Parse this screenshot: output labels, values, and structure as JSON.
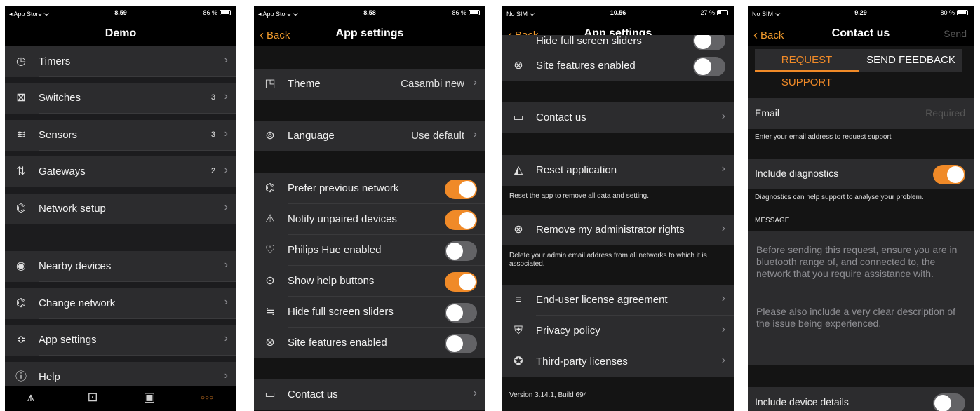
{
  "screens": [
    {
      "status": {
        "left": "◂ App Store ᯤ",
        "time": "8.59",
        "battery": "86 %"
      },
      "title": "Demo",
      "menu": [
        {
          "label": "Timers",
          "icon": "clock-icon",
          "count": ""
        },
        {
          "label": "Switches",
          "icon": "switch-icon",
          "count": "3"
        },
        {
          "label": "Sensors",
          "icon": "sensor-icon",
          "count": "3"
        },
        {
          "label": "Gateways",
          "icon": "gateway-icon",
          "count": "2"
        },
        {
          "label": "Network setup",
          "icon": "network-icon",
          "count": ""
        },
        {
          "label": "Nearby devices",
          "icon": "nearby-icon",
          "count": ""
        },
        {
          "label": "Change network",
          "icon": "change-network-icon",
          "count": ""
        },
        {
          "label": "App settings",
          "icon": "settings-sliders-icon",
          "count": ""
        },
        {
          "label": "Help",
          "icon": "info-icon",
          "count": ""
        }
      ],
      "tabs": [
        {
          "icon": "lamp-icon"
        },
        {
          "icon": "gallery-icon"
        },
        {
          "icon": "scenes-icon"
        },
        {
          "icon": "more-icon",
          "glyph": "○○○"
        }
      ]
    },
    {
      "status": {
        "left": "◂ App Store ᯤ",
        "time": "8.58",
        "battery": "86 %"
      },
      "back": "Back",
      "title": "App settings",
      "theme": {
        "label": "Theme",
        "value": "Casambi new"
      },
      "language": {
        "label": "Language",
        "value": "Use default"
      },
      "toggles": [
        {
          "label": "Prefer previous network",
          "on": true,
          "icon": "network-icon"
        },
        {
          "label": "Notify unpaired devices",
          "on": true,
          "icon": "alert-icon"
        },
        {
          "label": "Philips Hue enabled",
          "on": false,
          "icon": "heart-outline-icon"
        },
        {
          "label": "Show help buttons",
          "on": true,
          "icon": "help-toggle-icon"
        },
        {
          "label": "Hide full screen sliders",
          "on": false,
          "icon": "sliders-icon"
        },
        {
          "label": "Site features enabled",
          "on": false,
          "icon": "site-icon"
        }
      ],
      "contact": "Contact us"
    },
    {
      "status": {
        "left": "No SIM ᯤ",
        "time": "10.56",
        "battery": "27 %"
      },
      "back": "Back",
      "title": "App settings",
      "partial_label": "Hide full screen sliders",
      "site_features": "Site features enabled",
      "contact": "Contact us",
      "reset": {
        "label": "Reset application",
        "note": "Reset the app to remove all data and setting."
      },
      "remove_admin": {
        "label": "Remove my administrator rights",
        "note": "Delete your admin email address from all networks to which it is associated."
      },
      "legal": [
        {
          "label": "End-user license agreement",
          "icon": "document-icon"
        },
        {
          "label": "Privacy policy",
          "icon": "shield-icon"
        },
        {
          "label": "Third-party licenses",
          "icon": "award-icon"
        }
      ],
      "version": "Version 3.14.1, Build 694"
    },
    {
      "status": {
        "left": "No SIM ᯤ",
        "time": "9.29",
        "battery": "80 %"
      },
      "back": "Back",
      "title": "Contact us",
      "send": "Send",
      "segments": {
        "support": "REQUEST SUPPORT",
        "feedback": "SEND FEEDBACK"
      },
      "email": {
        "label": "Email",
        "placeholder": "Required",
        "note": "Enter your email address to request support"
      },
      "diagnostics": {
        "label": "Include diagnostics",
        "on": true,
        "note": "Diagnostics can help support to analyse your problem."
      },
      "message_header": "MESSAGE",
      "message_p1": "Before sending this request, ensure you are in bluetooth range of, and connected to, the network that you require assistance with.",
      "message_p2": "Please also include a very clear description of the issue being experienced.",
      "device_details": {
        "label": "Include device details",
        "on": false
      }
    }
  ],
  "colors": {
    "accent": "#f08a28",
    "cell": "#2c2c2e",
    "background": "#141414"
  }
}
